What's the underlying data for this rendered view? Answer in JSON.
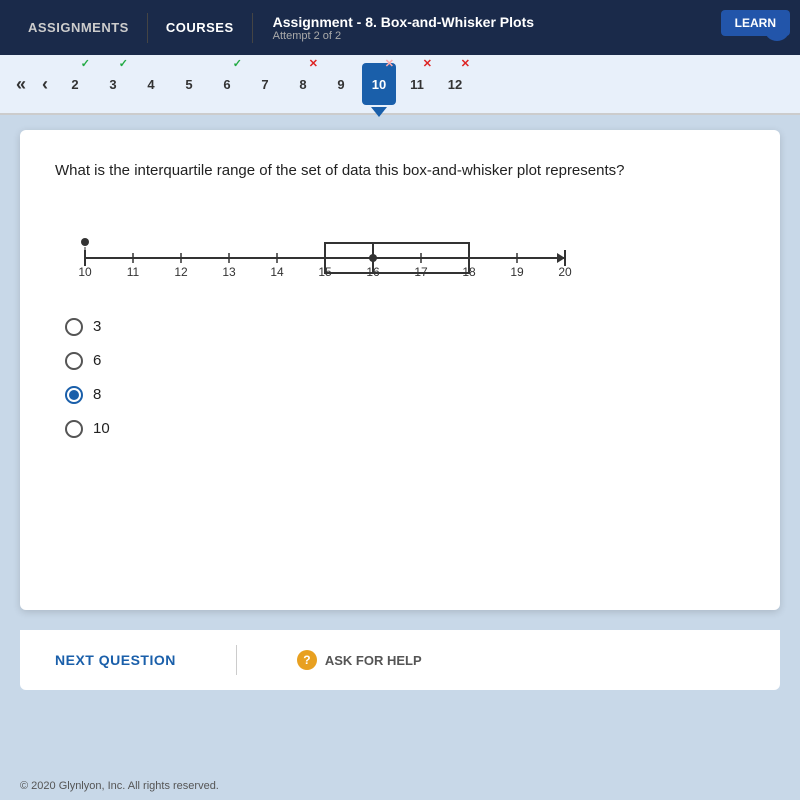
{
  "topNav": {
    "assignments_label": "ASSIGNMENTS",
    "courses_label": "COURSES",
    "assignment_title": "Assignment  - 8. Box-and-Whisker Plots",
    "attempt_label": "Attempt 2 of 2",
    "learn_label": "LEARN",
    "info_icon": "i"
  },
  "questionNav": {
    "back_double": "«",
    "back_single": "‹",
    "questions": [
      {
        "num": "2",
        "status": "correct"
      },
      {
        "num": "3",
        "status": "correct"
      },
      {
        "num": "4",
        "status": "none"
      },
      {
        "num": "5",
        "status": "none"
      },
      {
        "num": "6",
        "status": "correct"
      },
      {
        "num": "7",
        "status": "none"
      },
      {
        "num": "8",
        "status": "wrong"
      },
      {
        "num": "9",
        "status": "none"
      },
      {
        "num": "10",
        "status": "wrong",
        "current": true
      },
      {
        "num": "11",
        "status": "wrong"
      },
      {
        "num": "12",
        "status": "wrong"
      }
    ]
  },
  "question": {
    "text": "What is the interquartile range of the set of data this box-and-whisker plot represents?",
    "plot": {
      "min": 10,
      "q1": 15,
      "median": 16,
      "q3": 18,
      "max": 20,
      "axis_min": 10,
      "axis_max": 20
    },
    "options": [
      {
        "value": "3",
        "selected": false
      },
      {
        "value": "6",
        "selected": false
      },
      {
        "value": "8",
        "selected": true
      },
      {
        "value": "10",
        "selected": false
      }
    ]
  },
  "bottomBar": {
    "next_question_label": "NEXT QUESTION",
    "ask_help_label": "ASK FOR HELP",
    "help_icon": "?"
  },
  "footer": {
    "copyright": "© 2020 Glynlyon, Inc. All rights reserved."
  }
}
